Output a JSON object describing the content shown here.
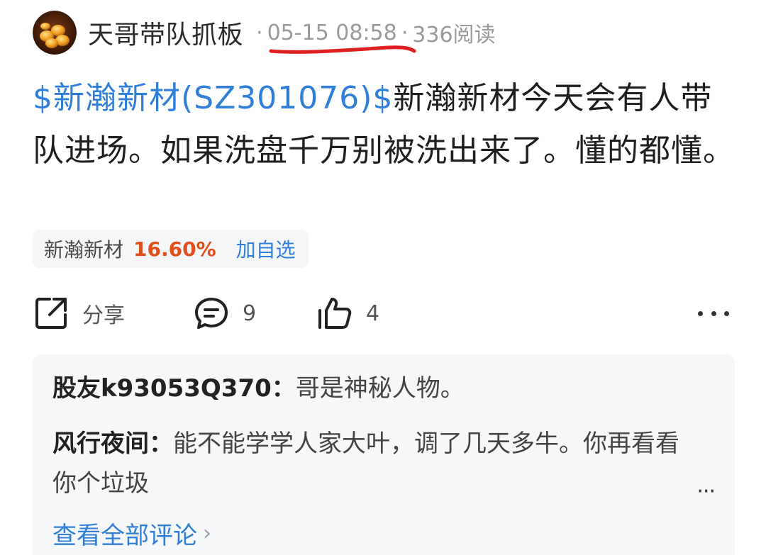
{
  "post": {
    "author": "天哥带队抓板",
    "date": "05-15 08:58",
    "views": "336阅读",
    "stock_link": "$新瀚新材(SZ301076)$",
    "text": "新瀚新材今天会有人带队进场。如果洗盘千万别被洗出来了。懂的都懂。"
  },
  "stock_chip": {
    "name": "新瀚新材",
    "change": "16.60%",
    "add_label": "加自选"
  },
  "actions": {
    "share_label": "分享",
    "comment_count": "9",
    "like_count": "4"
  },
  "comments": [
    {
      "author": "股友k93053Q370：",
      "text": "哥是神秘人物。"
    },
    {
      "author": "风行夜间：",
      "text": "能不能学学人家大叶，调了几天多牛。你再看看你个垃圾"
    }
  ],
  "view_all_label": "查看全部评论",
  "colors": {
    "link": "#2f7fd9",
    "rise": "#e0501c",
    "annotation": "#e02020"
  }
}
